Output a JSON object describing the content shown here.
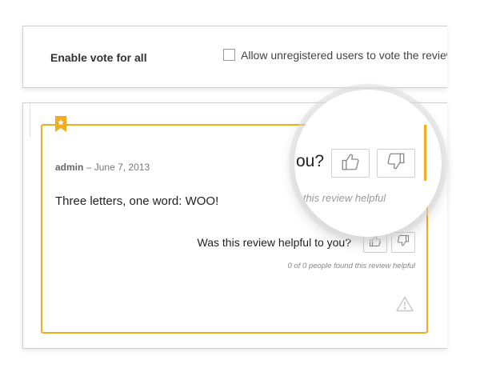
{
  "settings": {
    "enable_vote_label": "Enable vote for all",
    "allow_unregistered_label": "Allow unregistered users to vote the review",
    "allow_unregistered_checked": false
  },
  "review": {
    "author": "admin",
    "separator": "–",
    "date": "June 7, 2013",
    "text": "Three letters, one word: WOO!",
    "helpful_question": "Was this review helpful to you?",
    "helpful_stats": "0 of 0 people found this review helpful"
  },
  "magnified": {
    "question_fragment": "ou?",
    "stats_fragment": "d this review helpful"
  },
  "icons": {
    "bookmark": "star-bookmark-icon",
    "thumbs_up": "thumbs-up-icon",
    "thumbs_down": "thumbs-down-icon",
    "report": "warning-icon"
  },
  "colors": {
    "accent": "#f3ad1a",
    "icon_gray": "#8a8a8a",
    "border": "#cfcfcf"
  }
}
